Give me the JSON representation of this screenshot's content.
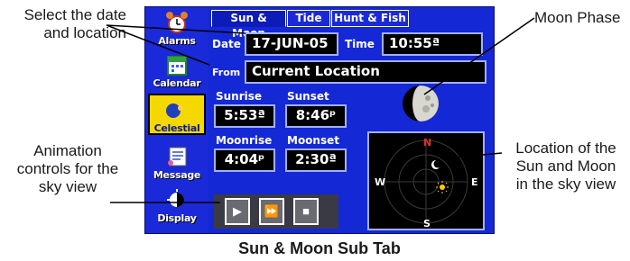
{
  "callouts": {
    "select_date": "Select the date\nand location",
    "animation": "Animation\ncontrols for the\nsky view",
    "moon_phase": "Moon Phase",
    "sky_location": "Location of the\nSun and Moon\nin the sky view"
  },
  "caption": "Sun & Moon Sub Tab",
  "sidebar": {
    "items": [
      {
        "label": "Alarms",
        "icon": "alarm-clock-icon"
      },
      {
        "label": "Calendar",
        "icon": "calendar-icon"
      },
      {
        "label": "Celestial",
        "icon": "celestial-icon"
      },
      {
        "label": "Message",
        "icon": "message-icon"
      },
      {
        "label": "Display",
        "icon": "display-icon"
      }
    ],
    "active": "Celestial"
  },
  "tabs": [
    {
      "label": "Sun & Moon",
      "active": true
    },
    {
      "label": "Tide",
      "active": false
    },
    {
      "label": "Hunt & Fish",
      "active": false
    }
  ],
  "date_row": {
    "date_label": "Date",
    "date_value": "17-JUN-05",
    "time_label": "Time",
    "time_value": "10:55ª"
  },
  "from_row": {
    "from_label": "From",
    "from_value": "Current Location"
  },
  "sun": {
    "sunrise_label": "Sunrise",
    "sunrise_value": "5:53ª",
    "sunset_label": "Sunset",
    "sunset_value": "8:46ᵖ"
  },
  "moon": {
    "moonrise_label": "Moonrise",
    "moonrise_value": "4:04ᵖ",
    "moonset_label": "Moonset",
    "moonset_value": "2:30ª"
  },
  "compass": {
    "n": "N",
    "s": "S",
    "e": "E",
    "w": "W"
  },
  "animation_controls": [
    {
      "name": "play-icon",
      "glyph": "▶"
    },
    {
      "name": "fast-forward-icon",
      "glyph": "⏩"
    },
    {
      "name": "stop-icon",
      "glyph": "■"
    }
  ],
  "colors": {
    "screen_bg": "#1528d6",
    "active_tab": "#0d1cb8",
    "highlight": "#f5d800",
    "value_box": "#000000"
  }
}
